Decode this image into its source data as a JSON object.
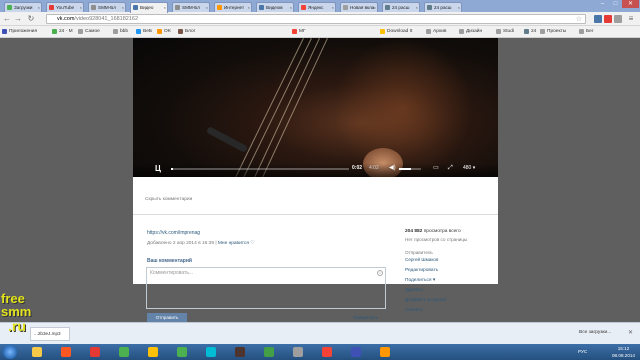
{
  "browser": {
    "tabs": [
      {
        "label": "Загрузки",
        "color": "#4caf50"
      },
      {
        "label": "YouTube",
        "color": "#e53935"
      },
      {
        "label": "SMM-Бл",
        "color": "#8e8e8e"
      },
      {
        "label": "Видео",
        "color": "#4a76a8",
        "active": true
      },
      {
        "label": "SMM-Бл",
        "color": "#8e8e8e"
      },
      {
        "label": "Интернет",
        "color": "#ff9800"
      },
      {
        "label": "Видеом",
        "color": "#4a76a8"
      },
      {
        "label": "Яндекс",
        "color": "#f44336"
      },
      {
        "label": "Новая вкла",
        "color": "#9e9e9e"
      },
      {
        "label": "24 расш",
        "color": "#607d8b"
      },
      {
        "label": "24 расш",
        "color": "#607d8b"
      }
    ],
    "window_controls": {
      "minimize": "–",
      "maximize": "□",
      "close": "✕"
    },
    "address": {
      "host": "vk.com",
      "path": "/video928041_168182162"
    },
    "bookmarks": [
      {
        "label": "Приложения",
        "color": "#3f51b5"
      },
      {
        "label": "24 · М",
        "color": "#4caf50"
      },
      {
        "label": "Самое",
        "color": "#9e9e9e"
      },
      {
        "label": "bbb",
        "color": "#9e9e9e"
      },
      {
        "label": "ВеБ",
        "color": "#2196f3"
      },
      {
        "label": "OK",
        "color": "#ff9800"
      },
      {
        "label": "Блог",
        "color": "#795548"
      },
      {
        "label": "МГ",
        "color": "#f44336"
      },
      {
        "label": "Download It",
        "color": "#ffc107"
      },
      {
        "label": "Архив",
        "color": "#9e9e9e"
      },
      {
        "label": "Дизайн",
        "color": "#9e9e9e"
      },
      {
        "label": "Studi",
        "color": "#9e9e9e"
      },
      {
        "label": "24",
        "color": "#607d8b"
      },
      {
        "label": "Проекты",
        "color": "#9e9e9e"
      },
      {
        "label": "Бег",
        "color": "#9e9e9e"
      }
    ]
  },
  "player": {
    "logo": "Ц",
    "current_time": "0:02",
    "duration": "4:02",
    "progress": 0.01,
    "volume": 0.55,
    "quality": "480 ▾"
  },
  "post": {
    "hide_comments": "Скрыть комментарии",
    "link": "https://vk.com/imprenag",
    "date": "Добавлено 2 апр 2014 в 16:39 |",
    "like": "Мне нравится ♡",
    "comment_heading": "Ваш комментарий",
    "comment_placeholder": "Комментировать...",
    "send_button": "Отправить",
    "attach_link": "Прикрепить"
  },
  "sidebar": {
    "views": "204 882",
    "views_suffix": "просмотра всего",
    "views_sub": "Нет просмотров со страницы",
    "sender_label": "Отправитель",
    "sender": "Сергей Шмаков",
    "actions": [
      "Редактировать",
      "Поделиться ▾",
      "Удалить",
      "Добавить в группа",
      "Скачать",
      "Скачать MP3/Mp3"
    ]
  },
  "downloads": {
    "file": "...2b3eJ.mp3",
    "show_all": "Все загрузки...",
    "close": "✕"
  },
  "watermark": {
    "line1": "free",
    "line2": "smm",
    "line3": ".ru"
  },
  "taskbar": {
    "icons": [
      "#f7c948",
      "#ff5722",
      "#e53935",
      "#4caf50",
      "#ffc107",
      "#4caf50",
      "#00bcd4",
      "#4e342e",
      "#43a047",
      "#9e9e9e",
      "#f44336",
      "#3f51b5",
      "#ff9800"
    ],
    "lang": "РУС",
    "time": "15:12",
    "date": "08.08.2014"
  }
}
